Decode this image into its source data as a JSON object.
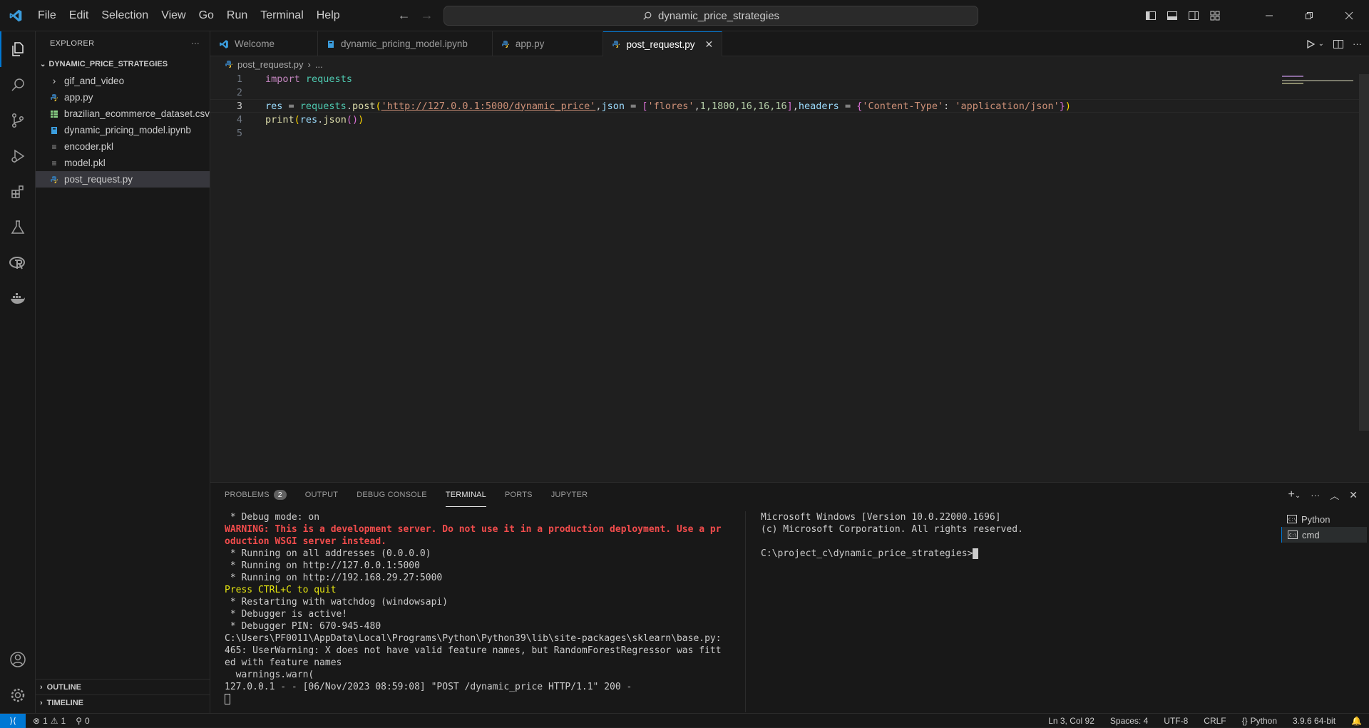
{
  "titlebar": {
    "menu": [
      "File",
      "Edit",
      "Selection",
      "View",
      "Go",
      "Run",
      "Terminal",
      "Help"
    ],
    "search_text": "dynamic_price_strategies"
  },
  "explorer": {
    "header": "EXPLORER",
    "folder": "DYNAMIC_PRICE_STRATEGIES",
    "items": [
      {
        "label": "gif_and_video",
        "kind": "folder"
      },
      {
        "label": "app.py",
        "kind": "python"
      },
      {
        "label": "brazilian_ecommerce_dataset.csv",
        "kind": "csv"
      },
      {
        "label": "dynamic_pricing_model.ipynb",
        "kind": "notebook"
      },
      {
        "label": "encoder.pkl",
        "kind": "pickle"
      },
      {
        "label": "model.pkl",
        "kind": "pickle"
      },
      {
        "label": "post_request.py",
        "kind": "python"
      }
    ],
    "outline": "OUTLINE",
    "timeline": "TIMELINE"
  },
  "tabs": [
    {
      "label": "Welcome"
    },
    {
      "label": "dynamic_pricing_model.ipynb"
    },
    {
      "label": "app.py"
    },
    {
      "label": "post_request.py"
    }
  ],
  "breadcrumb": {
    "file": "post_request.py",
    "rest": "..."
  },
  "code": {
    "line_numbers": [
      "1",
      "2",
      "3",
      "4",
      "5"
    ],
    "line1": {
      "kw": "import",
      "mod": "requests"
    },
    "line3": {
      "res": "res",
      "eq": " = ",
      "requests": "requests",
      "post": "post",
      "url": "'http://127.0.0.1:5000/dynamic_price'",
      "json_kw": "json",
      "flores": "'flores'",
      "nums": "1,1800,16,16,16",
      "headers_kw": "headers",
      "ct_key": "'Content-Type'",
      "ct_val": "'application/json'"
    },
    "line4": {
      "print": "print",
      "res": "res",
      "json": "json"
    }
  },
  "panel": {
    "tabs": [
      "PROBLEMS",
      "OUTPUT",
      "DEBUG CONSOLE",
      "TERMINAL",
      "PORTS",
      "JUPYTER"
    ],
    "problems_count": "2",
    "terminal1": {
      "l1": " * Debug mode: on",
      "warn1": "WARNING: This is a development server. Do not use it in a production deployment. Use a pr",
      "warn2": "oduction WSGI server instead.",
      "l4": " * Running on all addresses (0.0.0.0)",
      "l5": " * Running on http://127.0.0.1:5000",
      "l6": " * Running on http://192.168.29.27:5000",
      "quit": "Press CTRL+C to quit",
      "l8": " * Restarting with watchdog (windowsapi)",
      "l9": " * Debugger is active!",
      "l10": " * Debugger PIN: 670-945-480",
      "l11": "C:\\Users\\PF0011\\AppData\\Local\\Programs\\Python\\Python39\\lib\\site-packages\\sklearn\\base.py:",
      "l12": "465: UserWarning: X does not have valid feature names, but RandomForestRegressor was fitt",
      "l13": "ed with feature names",
      "l14": "  warnings.warn(",
      "l15": "127.0.0.1 - - [06/Nov/2023 08:59:08] \"POST /dynamic_price HTTP/1.1\" 200 -"
    },
    "terminal2": {
      "l1": "Microsoft Windows [Version 10.0.22000.1696]",
      "l2": "(c) Microsoft Corporation. All rights reserved.",
      "prompt": "C:\\project_c\\dynamic_price_strategies>"
    },
    "terminal_list": [
      "Python",
      "cmd"
    ]
  },
  "statusbar": {
    "errors": "1",
    "warnings": "1",
    "ports": "0",
    "position": "Ln 3, Col 92",
    "spaces": "Spaces: 4",
    "encoding": "UTF-8",
    "eol": "CRLF",
    "language": "Python",
    "interpreter": "3.9.6 64-bit"
  }
}
